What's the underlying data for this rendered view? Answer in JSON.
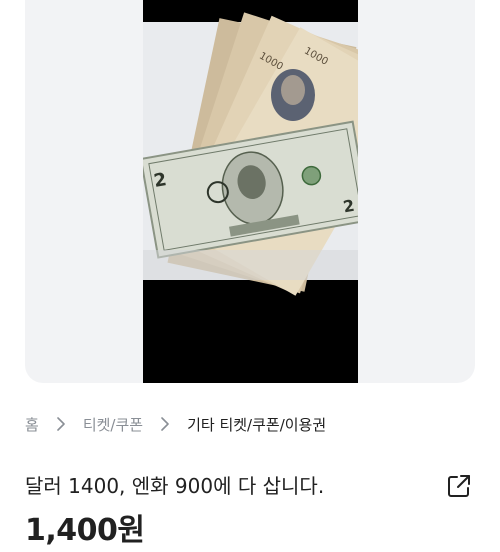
{
  "product": {
    "image_alt": "달러 1400, 엔화 900에 다 삽니다.",
    "title": "달러 1400, 엔화 900에 다 삽니다.",
    "price": "1,400원"
  },
  "breadcrumb": {
    "items": [
      {
        "label": "홈"
      },
      {
        "label": "티켓/쿠폰"
      },
      {
        "label": "기타 티켓/쿠폰/이용권"
      }
    ]
  },
  "icons": {
    "separator": "chevron-right-icon",
    "share": "share-external-icon"
  },
  "colors": {
    "background": "#ffffff",
    "gallery_bg": "#f2f3f5",
    "text_primary": "#212121",
    "text_secondary": "#8a8f96"
  }
}
